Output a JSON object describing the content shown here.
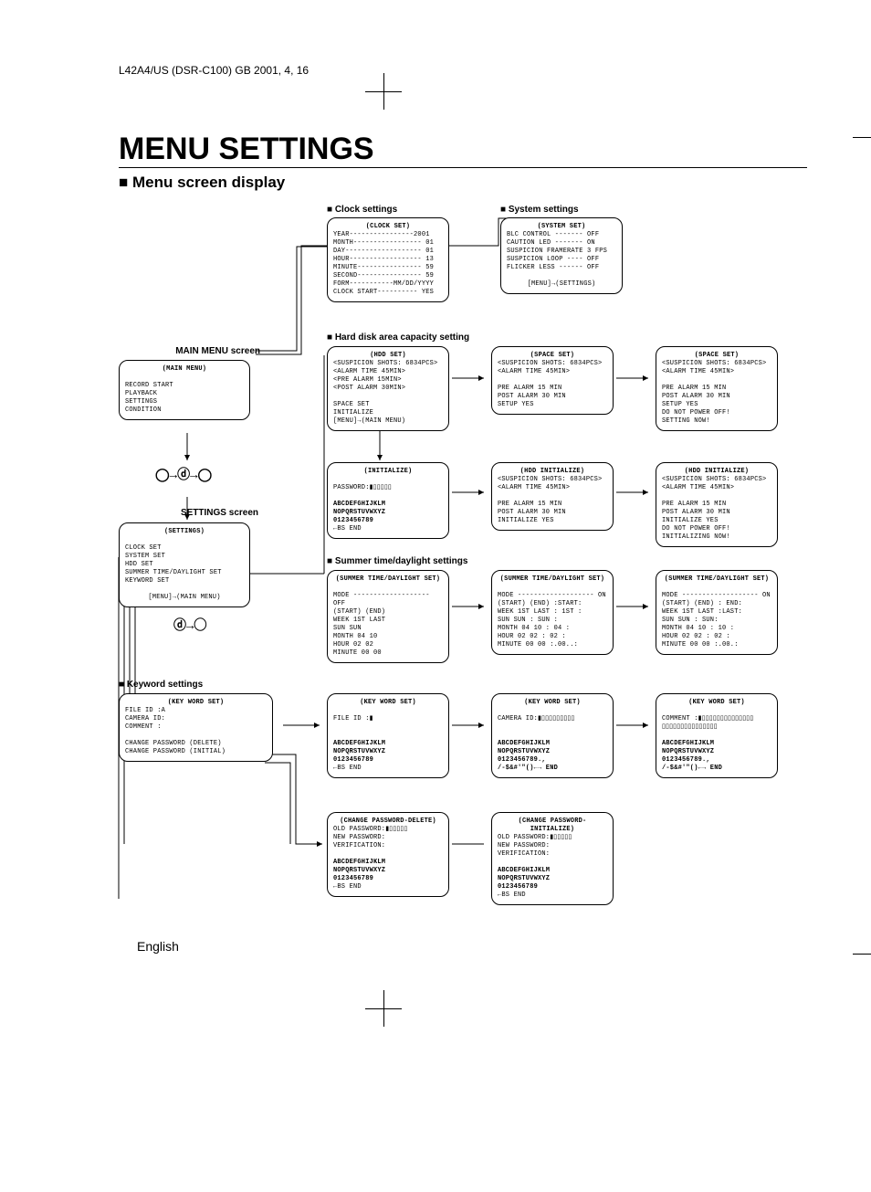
{
  "header": "L42A4/US (DSR-C100)   GB   2001, 4, 16",
  "title": "MENU SETTINGS",
  "subtitle": "Menu screen display",
  "footer": "English",
  "labels": {
    "clock": "Clock settings",
    "system": "System settings",
    "hdd": "Hard disk area capacity setting",
    "summer": "Summer time/daylight settings",
    "keyword": "Keyword settings",
    "main_menu": "MAIN MENU screen",
    "settings": "SETTINGS screen"
  },
  "main_menu_box": {
    "title": "(MAIN MENU)",
    "items": [
      "RECORD START",
      "PLAYBACK",
      "SETTINGS",
      "CONDITION"
    ]
  },
  "settings_box": {
    "title": "(SETTINGS)",
    "items": [
      "CLOCK SET",
      "SYSTEM SET",
      "HDD SET",
      "SUMMER TIME/DAYLIGHT SET",
      "KEYWORD SET"
    ],
    "foot": "[MENU]→(MAIN MENU)"
  },
  "clock_box": {
    "title": "(CLOCK SET)",
    "lines": [
      "YEAR----------------2001",
      "MONTH----------------- 01",
      "DAY------------------- 01",
      "HOUR------------------ 13",
      "MINUTE---------------- 59",
      "SECOND---------------- 59",
      "FORM-----------MM/DD/YYYY",
      "CLOCK START---------- YES"
    ]
  },
  "system_box": {
    "title": "(SYSTEM SET)",
    "lines": [
      "BLC CONTROL ------- OFF",
      "CAUTION LED ------- ON",
      "SUSPICION FRAMERATE 3 FPS",
      "SUSPICION LOOP ---- OFF",
      "FLICKER LESS ------ OFF"
    ],
    "foot": "[MENU]→(SETTINGS)"
  },
  "hdd_box": {
    "title": "(HDD SET)",
    "lines": [
      "<SUSPICION SHOTS: 6834PCS>",
      "<ALARM TIME       45MIN>",
      "<PRE ALARM        15MIN>",
      "<POST ALARM       30MIN>",
      "",
      "SPACE SET",
      "INITIALIZE",
      "   [MENU]→(MAIN MENU)"
    ]
  },
  "space_box_a": {
    "title": "(SPACE SET)",
    "lines": [
      "<SUSPICION SHOTS: 6834PCS>",
      "<ALARM TIME       45MIN>",
      "",
      "PRE ALARM        15 MIN",
      "POST ALARM       30 MIN",
      "SETUP            YES"
    ]
  },
  "space_box_b": {
    "title": "(SPACE SET)",
    "lines": [
      "<SUSPICION SHOTS: 6834PCS>",
      "<ALARM TIME       45MIN>",
      "",
      "PRE ALARM        15 MIN",
      "POST ALARM       30 MIN",
      "SETUP            YES",
      "  DO NOT POWER OFF!",
      "  SETTING NOW!"
    ]
  },
  "init_box": {
    "title": "(INITIALIZE)",
    "lines": [
      "",
      "PASSWORD:▮▯▯▯▯▯",
      "",
      "ABCDEFGHIJKLM",
      "NOPQRSTUVWXYZ",
      "0123456789",
      "            ←BS END"
    ]
  },
  "hdd_init_a": {
    "title": "(HDD INITIALIZE)",
    "lines": [
      "<SUSPICION SHOTS: 6834PCS>",
      "<ALARM TIME       45MIN>",
      "",
      "PRE ALARM        15 MIN",
      "POST ALARM       30 MIN",
      "INITIALIZE       YES"
    ]
  },
  "hdd_init_b": {
    "title": "(HDD INITIALIZE)",
    "lines": [
      "<SUSPICION SHOTS: 6834PCS>",
      "<ALARM TIME       45MIN>",
      "",
      "PRE ALARM        15 MIN",
      "POST ALARM       30 MIN",
      "INITIALIZE       YES",
      "  DO NOT POWER OFF!",
      "  INITIALIZING NOW!"
    ]
  },
  "summer_a": {
    "title": "(SUMMER TIME/DAYLIGHT SET)",
    "lines": [
      "MODE ------------------- OFF",
      "        (START) (END)",
      "WEEK     1ST    LAST",
      "         SUN    SUN",
      "MONTH    04     10",
      "HOUR     02     02",
      "MINUTE   00     00"
    ]
  },
  "summer_b": {
    "title": "(SUMMER TIME/DAYLIGHT SET)",
    "lines": [
      "MODE ------------------- ON",
      "     (START) (END) :START:",
      "WEEK  1ST   LAST  : 1ST :",
      "      SUN   SUN   : SUN :",
      "MONTH 04    10    : 04  :",
      "HOUR  02    02    : 02  :",
      "MINUTE 00   00    :.00..:"
    ]
  },
  "summer_c": {
    "title": "(SUMMER TIME/DAYLIGHT SET)",
    "lines": [
      "MODE ------------------- ON",
      "     (START) (END) : END:",
      "WEEK  1ST   LAST  :LAST:",
      "      SUN   SUN   : SUN:",
      "MONTH 04    10    : 10 :",
      "HOUR  02    02    : 02 :",
      "MINUTE 00   00    :.00.:"
    ]
  },
  "keyword_main": {
    "title": "(KEY WORD SET)",
    "lines": [
      "FILE ID  :A",
      "CAMERA ID:",
      "COMMENT  :",
      "",
      "CHANGE PASSWORD (DELETE)",
      "CHANGE PASSWORD (INITIAL)"
    ]
  },
  "keyword_file": {
    "title": "(KEY WORD SET)",
    "lines": [
      "FILE ID  :▮",
      "",
      "",
      "ABCDEFGHIJKLM",
      "NOPQRSTUVWXYZ",
      "0123456789",
      "            ←BS END"
    ]
  },
  "keyword_camera": {
    "title": "(KEY WORD SET)",
    "lines": [
      "CAMERA ID:▮▯▯▯▯▯▯▯▯▯",
      "",
      "",
      "ABCDEFGHIJKLM",
      "NOPQRSTUVWXYZ",
      "0123456789.,",
      "/-$&#'\"()←→ END"
    ]
  },
  "keyword_comment": {
    "title": "(KEY WORD SET)",
    "lines": [
      "COMMENT  :▮▯▯▯▯▯▯▯▯▯▯▯▯▯▯",
      "          ▯▯▯▯▯▯▯▯▯▯▯▯▯▯▯",
      "",
      "ABCDEFGHIJKLM",
      "NOPQRSTUVWXYZ",
      "0123456789.,",
      "/-$&#'\"()←→ END"
    ]
  },
  "pass_delete": {
    "title": "(CHANGE PASSWORD-DELETE)",
    "lines": [
      "OLD PASSWORD:▮▯▯▯▯▯",
      "NEW PASSWORD:",
      "VERIFICATION:",
      "",
      "ABCDEFGHIJKLM",
      "NOPQRSTUVWXYZ",
      "0123456789",
      "            ←BS END"
    ]
  },
  "pass_init": {
    "title": "(CHANGE PASSWORD-INITIALIZE)",
    "lines": [
      "OLD PASSWORD:▮▯▯▯▯▯",
      "NEW PASSWORD:",
      "VERIFICATION:",
      "",
      "ABCDEFGHIJKLM",
      "NOPQRSTUVWXYZ",
      "0123456789",
      "            ←BS END"
    ]
  },
  "joystick1": "◯→ⓓ→◯",
  "joystick2": "ⓓ→◯"
}
